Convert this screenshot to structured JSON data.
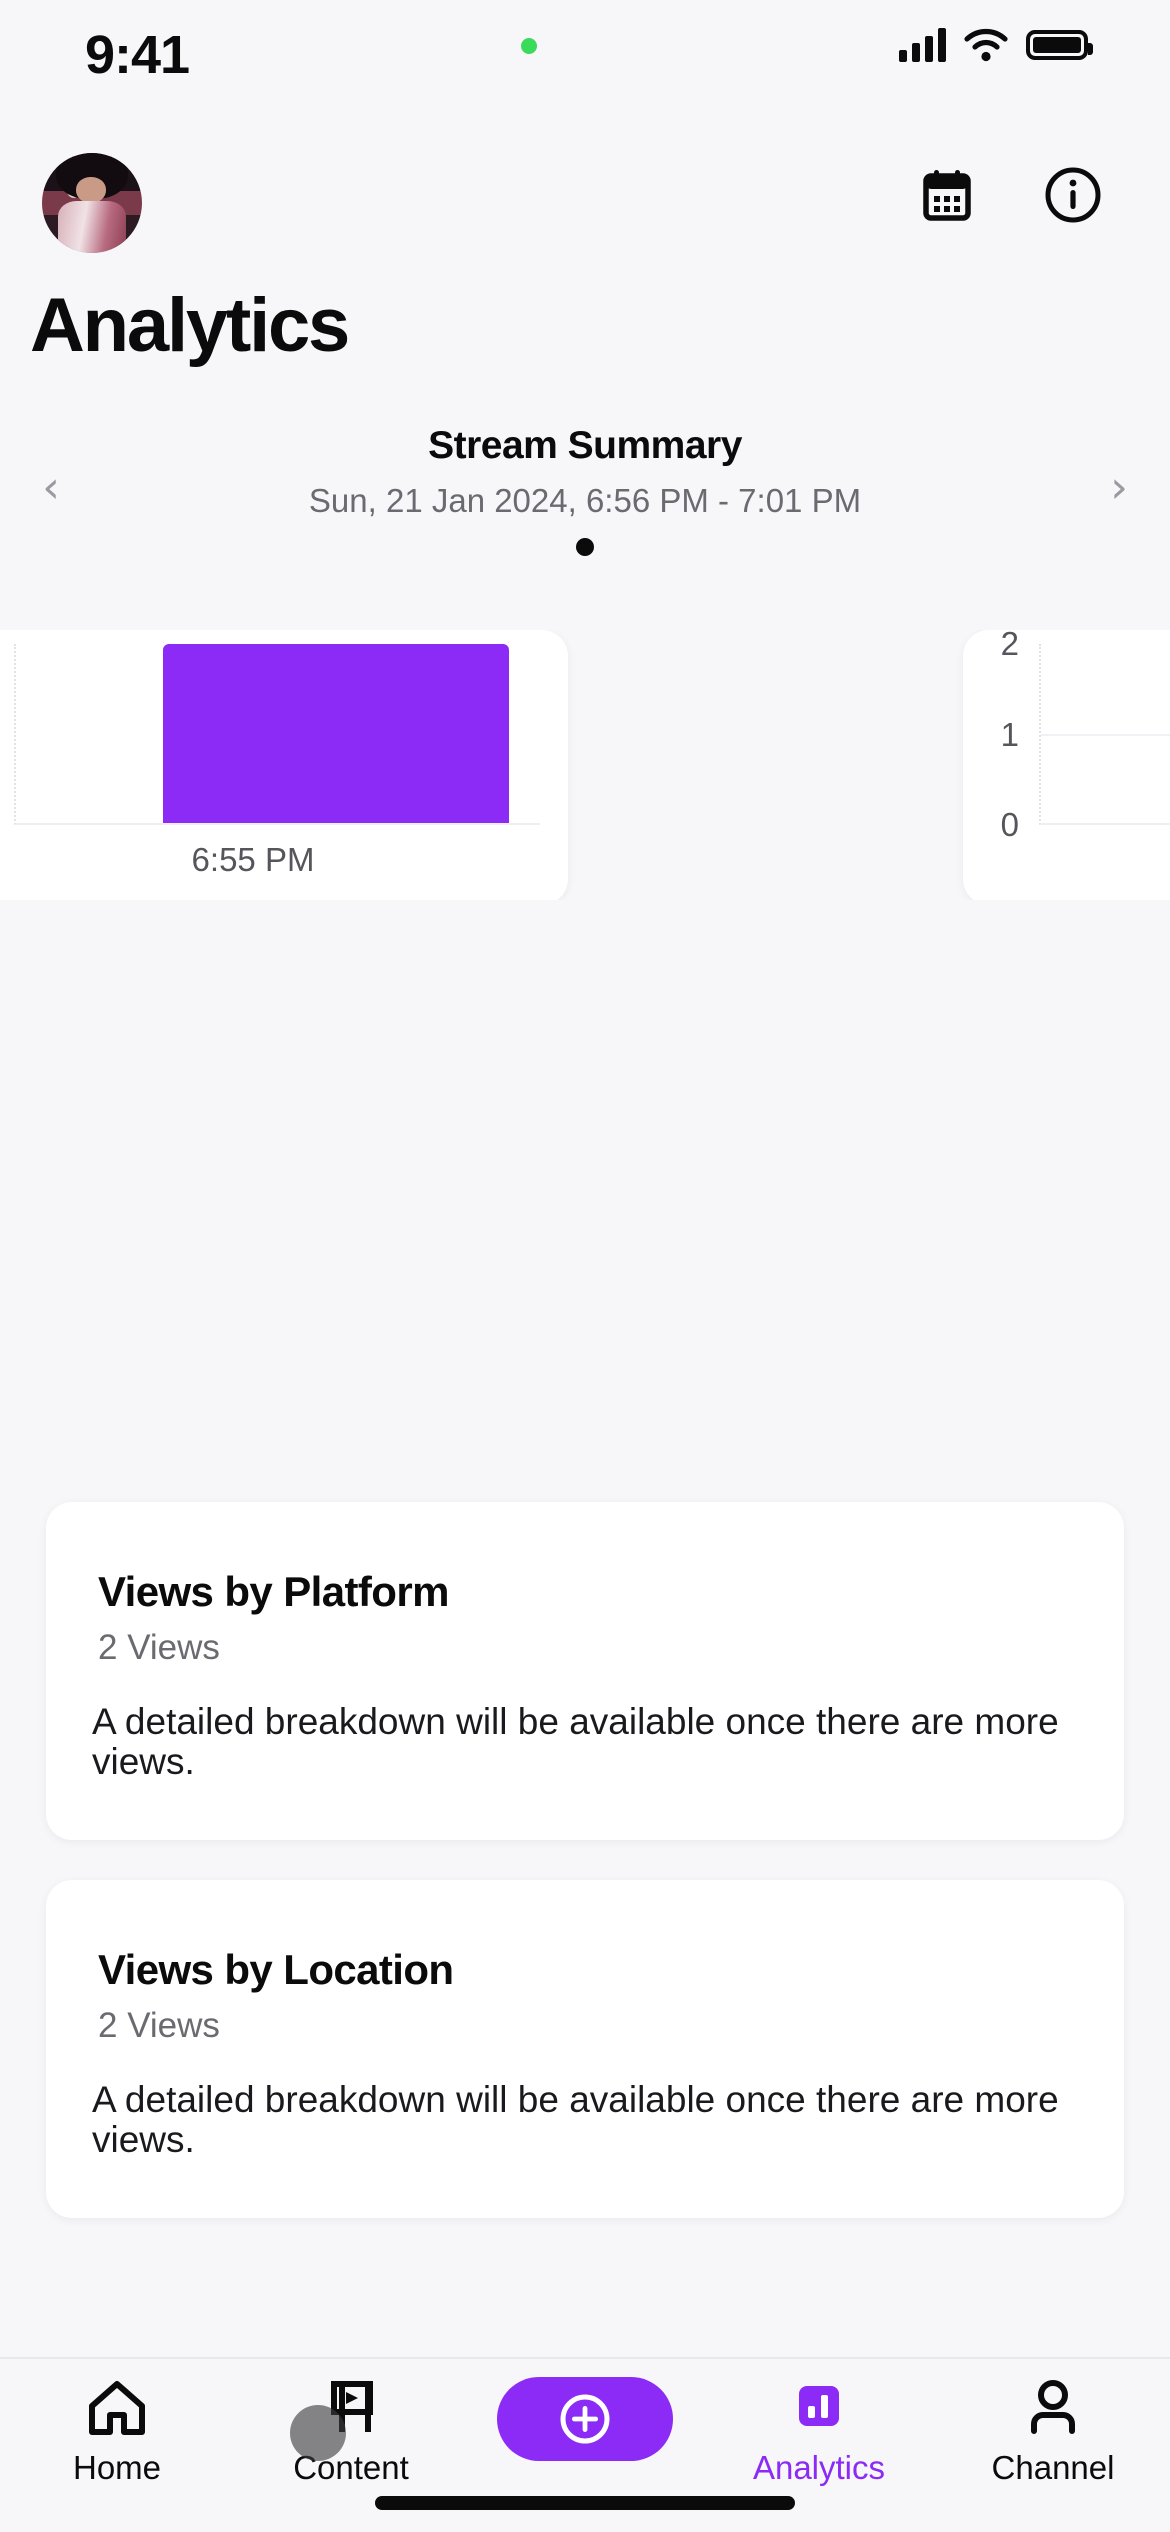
{
  "status_bar": {
    "time": "9:41",
    "recording_dot": "green-recording-dot",
    "signal_icon": "cellular-signal-icon",
    "wifi_icon": "wifi-icon",
    "battery_icon": "battery-full-icon"
  },
  "header": {
    "avatar": "user-avatar",
    "calendar_icon": "calendar-icon",
    "info_icon": "info-circle-icon",
    "page_title": "Analytics"
  },
  "summary": {
    "title": "Stream Summary",
    "date_range": "Sun, 21 Jan 2024, 6:56 PM - 7:01 PM",
    "prev_label": "‹",
    "next_label": "›",
    "page_count": 1,
    "active_page": 0
  },
  "chart_data": [
    {
      "type": "bar",
      "title": "",
      "categories": [
        "6:55 PM"
      ],
      "values": [
        2
      ],
      "xlabel": "",
      "ylabel": "",
      "ylim": [
        0,
        2
      ],
      "bar_color": "#8B2BF5",
      "grid": true,
      "legend": "none",
      "x_tick_labels": [
        "6:55 PM"
      ],
      "y_tick_labels": []
    },
    {
      "type": "bar",
      "title": "",
      "categories": [],
      "values": [],
      "xlabel": "",
      "ylabel": "",
      "ylim": [
        0,
        2
      ],
      "bar_color": "#8B2BF5",
      "grid": true,
      "legend": "none",
      "x_tick_labels": [],
      "y_tick_labels": [
        "2",
        "1",
        "0"
      ]
    }
  ],
  "cards": [
    {
      "title": "Views by Platform",
      "subtitle": "2 Views",
      "body": "A detailed breakdown will be available once there are more views."
    },
    {
      "title": "Views by Location",
      "subtitle": "2 Views",
      "body": "A detailed breakdown will be available once there are more views."
    }
  ],
  "tab_bar": {
    "items": [
      {
        "label": "Home",
        "icon": "home-icon",
        "active": false
      },
      {
        "label": "Content",
        "icon": "clapper-play-icon",
        "active": false
      },
      {
        "label": "",
        "icon": "plus-circle-icon",
        "active": false
      },
      {
        "label": "Analytics",
        "icon": "bar-chart-icon",
        "active": true
      },
      {
        "label": "Channel",
        "icon": "person-icon",
        "active": false
      }
    ],
    "accent_color": "#8B2BF5"
  }
}
